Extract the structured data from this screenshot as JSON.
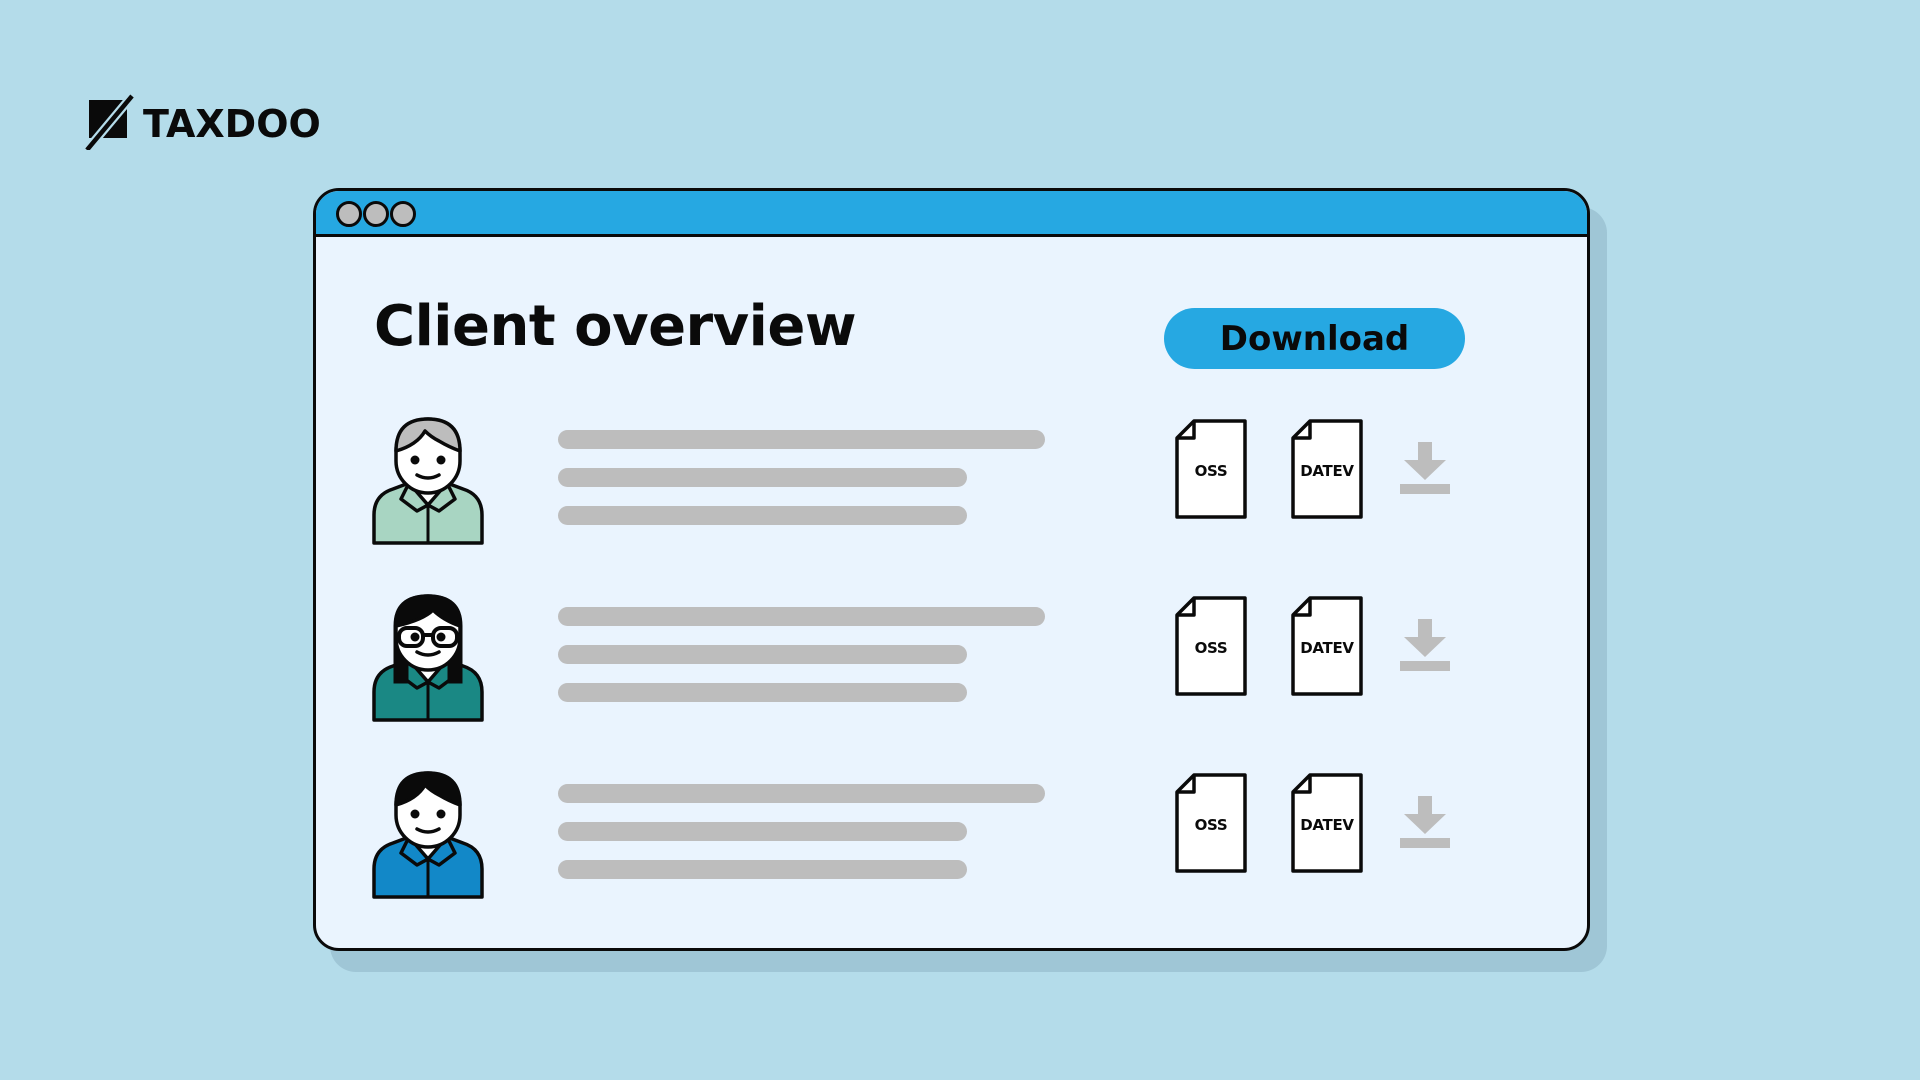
{
  "brand": {
    "name": "TAXDOO",
    "logo_icon": "taxdoo-slash-square-icon"
  },
  "window": {
    "controls": [
      "window-dot",
      "window-dot",
      "window-dot"
    ],
    "page_title": "Client overview",
    "download_button_label": "Download"
  },
  "colors": {
    "background": "#b4dcea",
    "accent": "#26a8e2",
    "window_bg": "#eaf4fe",
    "placeholder_bar": "#bdbdbd",
    "avatar_shirts": [
      "#a8d5c2",
      "#1a8884",
      "#1288c8"
    ]
  },
  "clients": [
    {
      "avatar": "avatar-man-gray-hair-icon",
      "shirt_color": "#a8d5c2",
      "hair_color": "#bdbdbd",
      "documents": [
        "OSS",
        "DATEV"
      ],
      "download_icon": "download-icon"
    },
    {
      "avatar": "avatar-woman-glasses-icon",
      "shirt_color": "#1a8884",
      "hair_color": "#0a0a0a",
      "documents": [
        "OSS",
        "DATEV"
      ],
      "download_icon": "download-icon"
    },
    {
      "avatar": "avatar-man-dark-hair-icon",
      "shirt_color": "#1288c8",
      "hair_color": "#0a0a0a",
      "documents": [
        "OSS",
        "DATEV"
      ],
      "download_icon": "download-icon"
    }
  ]
}
